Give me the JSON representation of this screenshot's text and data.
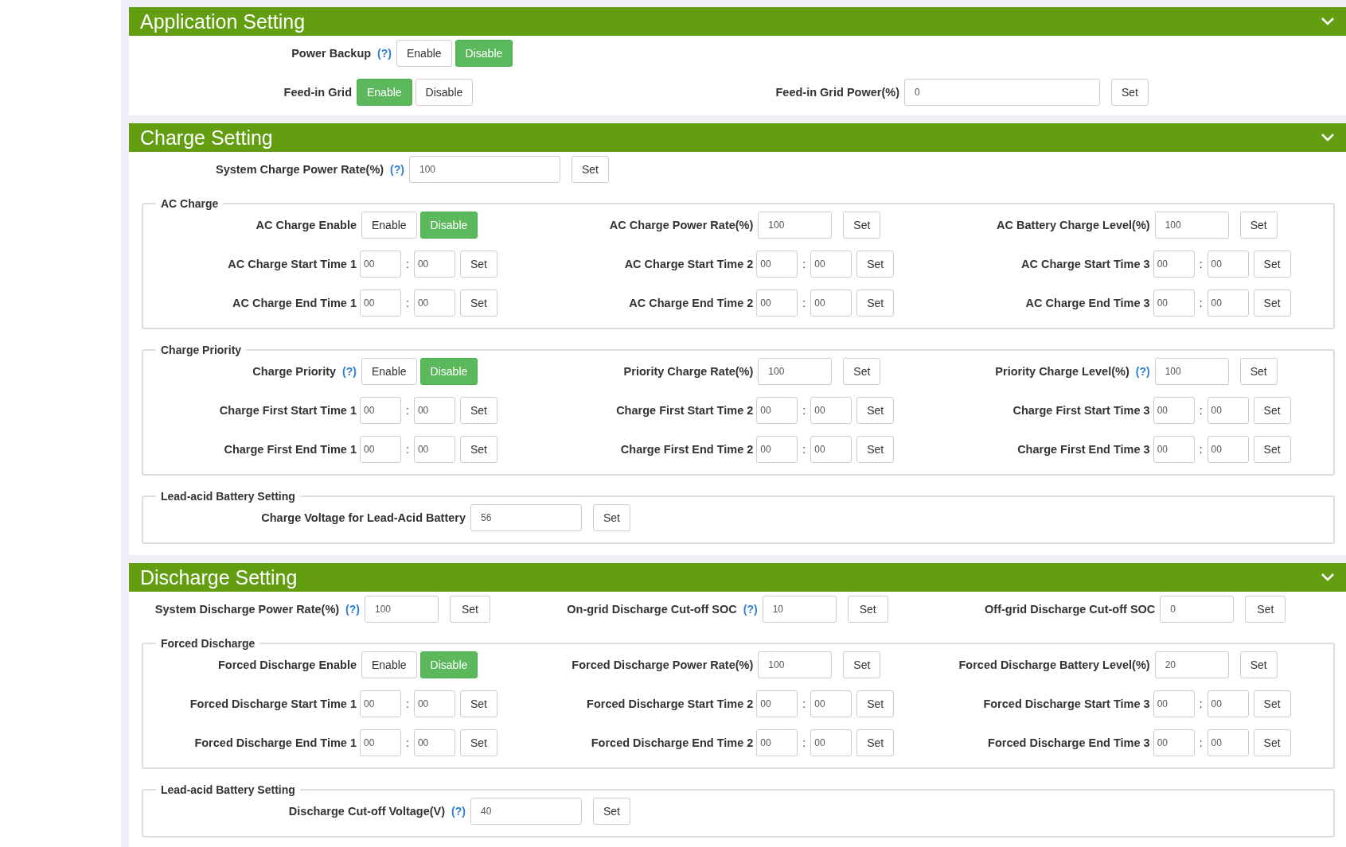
{
  "sections": [
    {
      "title": "Application Setting",
      "expanded": true,
      "rows": [
        [
          {
            "kind": "toggle",
            "label": "Power Backup",
            "help": "(?)",
            "options": [
              {
                "label": "Enable",
                "selected": false
              },
              {
                "label": "Disable",
                "selected": true
              }
            ]
          }
        ],
        [
          {
            "kind": "toggle",
            "label": "Feed-in Grid",
            "options": [
              {
                "label": "Enable",
                "selected": true
              },
              {
                "label": "Disable",
                "selected": false
              }
            ]
          },
          {
            "kind": "value",
            "label": "Feed-in Grid Power(%)",
            "value": "0",
            "button": "Set"
          }
        ]
      ]
    },
    {
      "title": "Charge Setting",
      "expanded": true,
      "rows": [
        [
          {
            "kind": "value",
            "label": "System Charge Power Rate(%)",
            "help": "(?)",
            "value": "100",
            "button": "Set"
          }
        ]
      ],
      "groups": [
        {
          "legend": "AC Charge",
          "rows": [
            [
              {
                "kind": "toggle",
                "label": "AC Charge Enable",
                "options": [
                  {
                    "label": "Enable",
                    "selected": false
                  },
                  {
                    "label": "Disable",
                    "selected": true
                  }
                ]
              },
              {
                "kind": "value",
                "label": "AC Charge Power Rate(%)",
                "value": "100",
                "button": "Set"
              },
              {
                "kind": "value",
                "label": "AC Battery Charge Level(%)",
                "value": "100",
                "button": "Set"
              }
            ],
            [
              {
                "kind": "time",
                "label": "AC Charge Start Time 1",
                "hour": "00",
                "separator": ":",
                "minute": "00",
                "button": "Set"
              },
              {
                "kind": "time",
                "label": "AC Charge Start Time 2",
                "hour": "00",
                "separator": ":",
                "minute": "00",
                "button": "Set"
              },
              {
                "kind": "time",
                "label": "AC Charge Start Time 3",
                "hour": "00",
                "separator": ":",
                "minute": "00",
                "button": "Set"
              }
            ],
            [
              {
                "kind": "time",
                "label": "AC Charge End Time 1",
                "hour": "00",
                "separator": ":",
                "minute": "00",
                "button": "Set"
              },
              {
                "kind": "time",
                "label": "AC Charge End Time 2",
                "hour": "00",
                "separator": ":",
                "minute": "00",
                "button": "Set"
              },
              {
                "kind": "time",
                "label": "AC Charge End Time 3",
                "hour": "00",
                "separator": ":",
                "minute": "00",
                "button": "Set"
              }
            ]
          ]
        },
        {
          "legend": "Charge Priority",
          "rows": [
            [
              {
                "kind": "toggle",
                "label": "Charge Priority",
                "help": "(?)",
                "options": [
                  {
                    "label": "Enable",
                    "selected": false
                  },
                  {
                    "label": "Disable",
                    "selected": true
                  }
                ]
              },
              {
                "kind": "value",
                "label": "Priority Charge Rate(%)",
                "value": "100",
                "button": "Set"
              },
              {
                "kind": "value",
                "label": "Priority Charge Level(%)",
                "help": "(?)",
                "value": "100",
                "button": "Set"
              }
            ],
            [
              {
                "kind": "time",
                "label": "Charge First Start Time 1",
                "hour": "00",
                "separator": ":",
                "minute": "00",
                "button": "Set"
              },
              {
                "kind": "time",
                "label": "Charge First Start Time 2",
                "hour": "00",
                "separator": ":",
                "minute": "00",
                "button": "Set"
              },
              {
                "kind": "time",
                "label": "Charge First Start Time 3",
                "hour": "00",
                "separator": ":",
                "minute": "00",
                "button": "Set"
              }
            ],
            [
              {
                "kind": "time",
                "label": "Charge First End Time 1",
                "hour": "00",
                "separator": ":",
                "minute": "00",
                "button": "Set"
              },
              {
                "kind": "time",
                "label": "Charge First End Time 2",
                "hour": "00",
                "separator": ":",
                "minute": "00",
                "button": "Set"
              },
              {
                "kind": "time",
                "label": "Charge First End Time 3",
                "hour": "00",
                "separator": ":",
                "minute": "00",
                "button": "Set"
              }
            ]
          ]
        },
        {
          "legend": "Lead-acid Battery Setting",
          "rows": [
            [
              {
                "kind": "value",
                "label": "Charge Voltage for Lead-Acid Battery",
                "value": "56",
                "button": "Set"
              }
            ]
          ]
        }
      ]
    },
    {
      "title": "Discharge Setting",
      "expanded": true,
      "rows": [
        [
          {
            "kind": "value",
            "label": "System Discharge Power Rate(%)",
            "help": "(?)",
            "value": "100",
            "button": "Set"
          },
          {
            "kind": "value",
            "label": "On-grid Discharge Cut-off SOC",
            "help": "(?)",
            "value": "10",
            "button": "Set"
          },
          {
            "kind": "value",
            "label": "Off-grid Discharge Cut-off SOC",
            "value": "0",
            "button": "Set"
          }
        ]
      ],
      "groups": [
        {
          "legend": "Forced Discharge",
          "rows": [
            [
              {
                "kind": "toggle",
                "label": "Forced Discharge Enable",
                "options": [
                  {
                    "label": "Enable",
                    "selected": false
                  },
                  {
                    "label": "Disable",
                    "selected": true
                  }
                ]
              },
              {
                "kind": "value",
                "label": "Forced Discharge Power Rate(%)",
                "value": "100",
                "button": "Set"
              },
              {
                "kind": "value",
                "label": "Forced Discharge Battery Level(%)",
                "value": "20",
                "button": "Set"
              }
            ],
            [
              {
                "kind": "time",
                "label": "Forced Discharge Start Time 1",
                "hour": "00",
                "separator": ":",
                "minute": "00",
                "button": "Set"
              },
              {
                "kind": "time",
                "label": "Forced Discharge Start Time 2",
                "hour": "00",
                "separator": ":",
                "minute": "00",
                "button": "Set"
              },
              {
                "kind": "time",
                "label": "Forced Discharge Start Time 3",
                "hour": "00",
                "separator": ":",
                "minute": "00",
                "button": "Set"
              }
            ],
            [
              {
                "kind": "time",
                "label": "Forced Discharge End Time 1",
                "hour": "00",
                "separator": ":",
                "minute": "00",
                "button": "Set"
              },
              {
                "kind": "time",
                "label": "Forced Discharge End Time 2",
                "hour": "00",
                "separator": ":",
                "minute": "00",
                "button": "Set"
              },
              {
                "kind": "time",
                "label": "Forced Discharge End Time 3",
                "hour": "00",
                "separator": ":",
                "minute": "00",
                "button": "Set"
              }
            ]
          ]
        },
        {
          "legend": "Lead-acid Battery Setting",
          "rows": [
            [
              {
                "kind": "value",
                "label": "Discharge Cut-off Voltage(V)",
                "help": "(?)",
                "value": "40",
                "button": "Set"
              }
            ]
          ]
        }
      ]
    }
  ]
}
